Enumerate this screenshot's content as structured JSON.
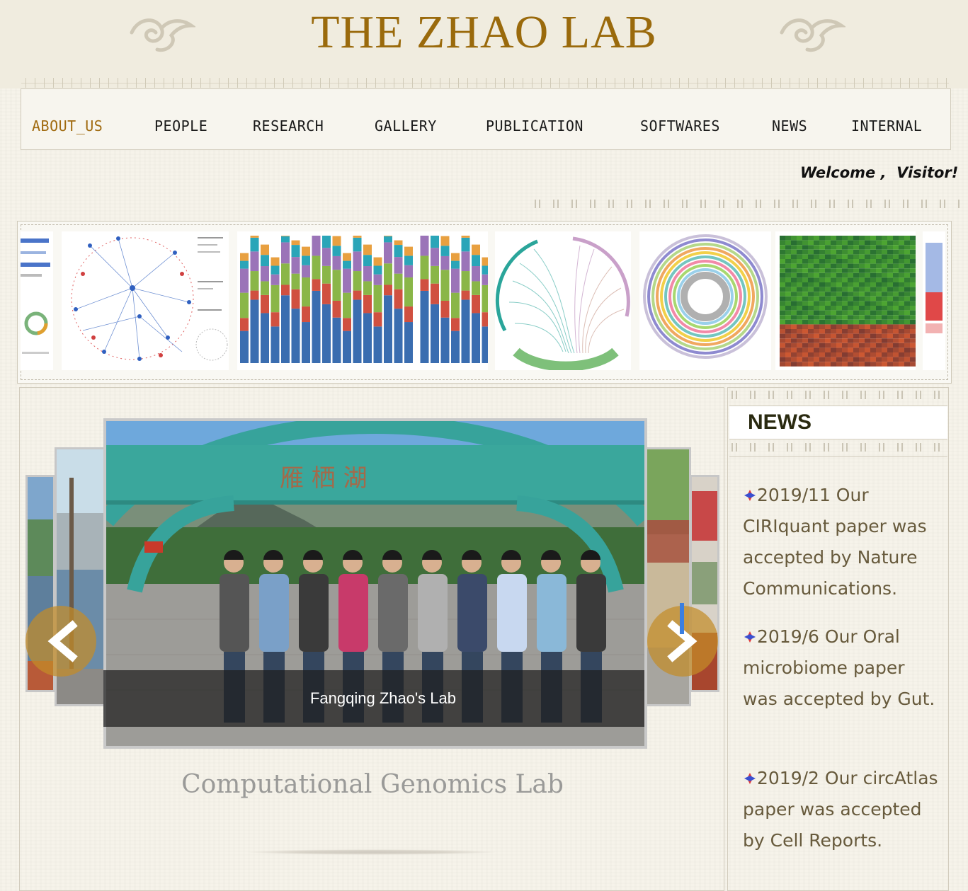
{
  "header": {
    "title": "THE ZHAO LAB"
  },
  "nav": {
    "items": [
      {
        "label": "ABOUT_US",
        "active": true
      },
      {
        "label": "PEOPLE"
      },
      {
        "label": "RESEARCH"
      },
      {
        "label": "GALLERY"
      },
      {
        "label": "PUBLICATION"
      },
      {
        "label": "SOFTWARES"
      },
      {
        "label": "NEWS"
      },
      {
        "label": "INTERNAL"
      }
    ]
  },
  "welcome": {
    "text": "Welcome ,  Visitor!"
  },
  "carousel": {
    "caption": "Fangqing Zhao's Lab",
    "subtitle": "Computational Genomics Lab"
  },
  "news": {
    "title": "NEWS",
    "items": [
      {
        "text": "2019/11 Our CIRIquant paper was accepted by Nature Communications."
      },
      {
        "text": "2019/6 Our Oral microbiome paper was accepted by Gut."
      },
      {
        "text": "2019/2 Our circAtlas paper was accepted by Cell Reports."
      }
    ]
  },
  "colors": {
    "accent": "#9a6a0c",
    "background": "#f6f3ea",
    "news_text": "#675a3c",
    "arrow": "#c48c28"
  },
  "icons": [
    "ornament-left-icon",
    "ornament-right-icon",
    "chevron-left-icon",
    "chevron-right-icon",
    "news-bullet-icon"
  ]
}
